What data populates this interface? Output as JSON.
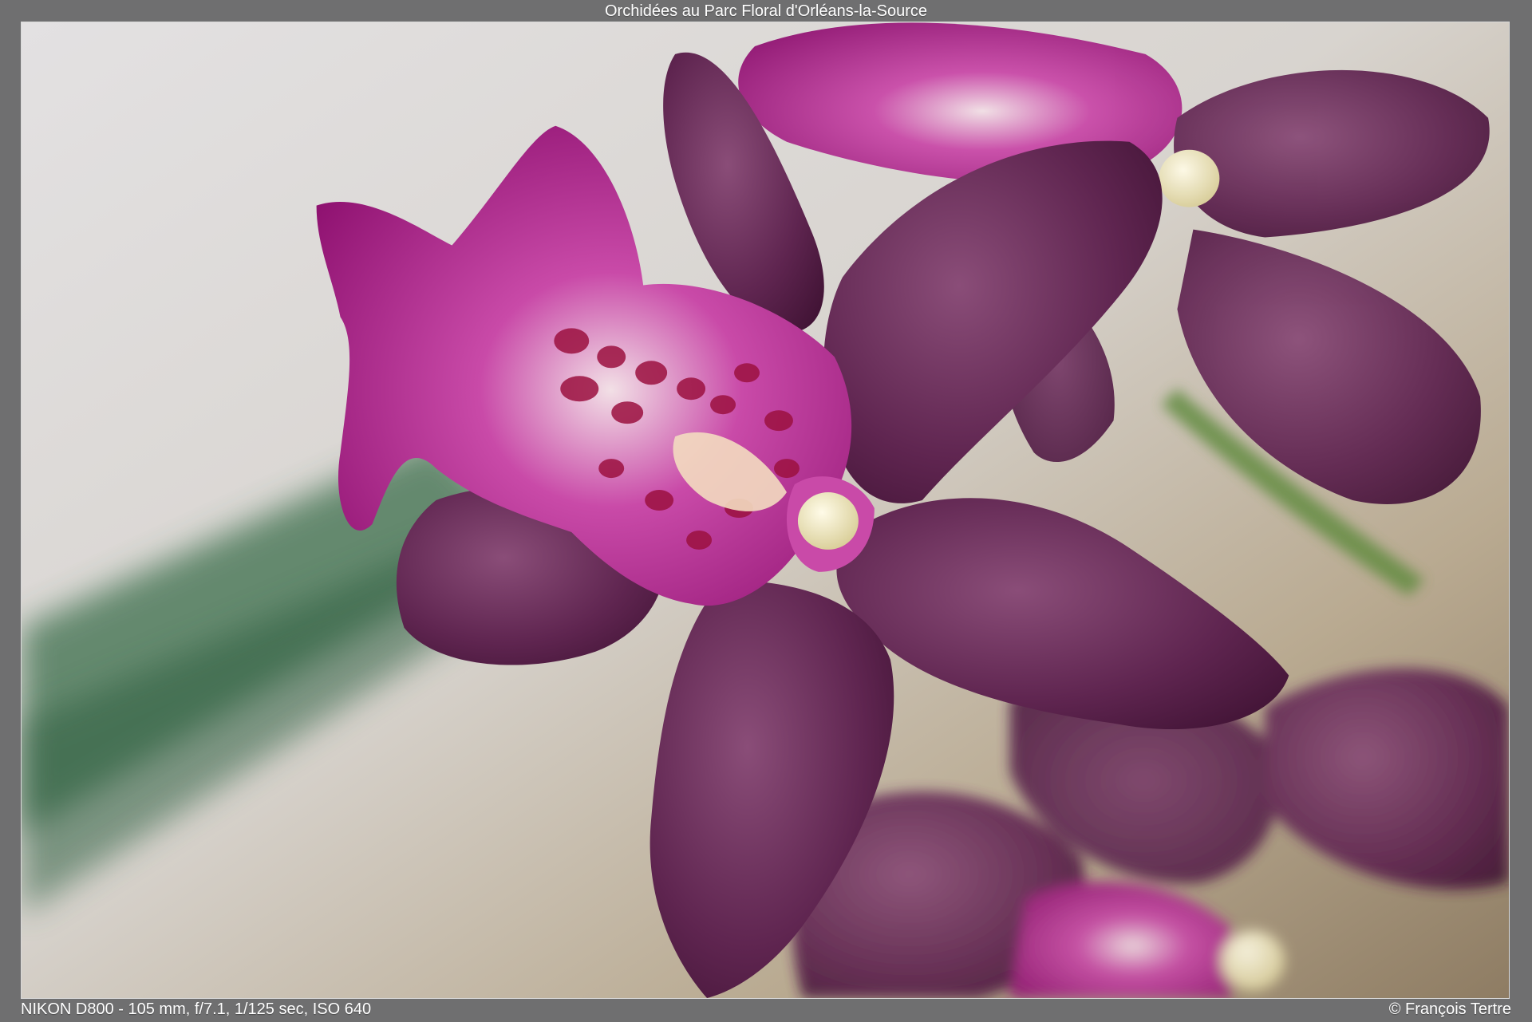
{
  "photo": {
    "title": "Orchidées au Parc Floral d'Orléans-la-Source",
    "camera_info": "NIKON D800 - 105 mm, f/7.1, 1/125 sec, ISO 640",
    "credit": "© François Tertre",
    "subject_icon": "orchid-flower"
  },
  "colors": {
    "frame_background": "#6f6f70",
    "petal_dark": "#5a1f48",
    "lip_magenta": "#a4147f",
    "column_cream": "#efe8c5",
    "leaf_green": "#3e6f4d"
  }
}
